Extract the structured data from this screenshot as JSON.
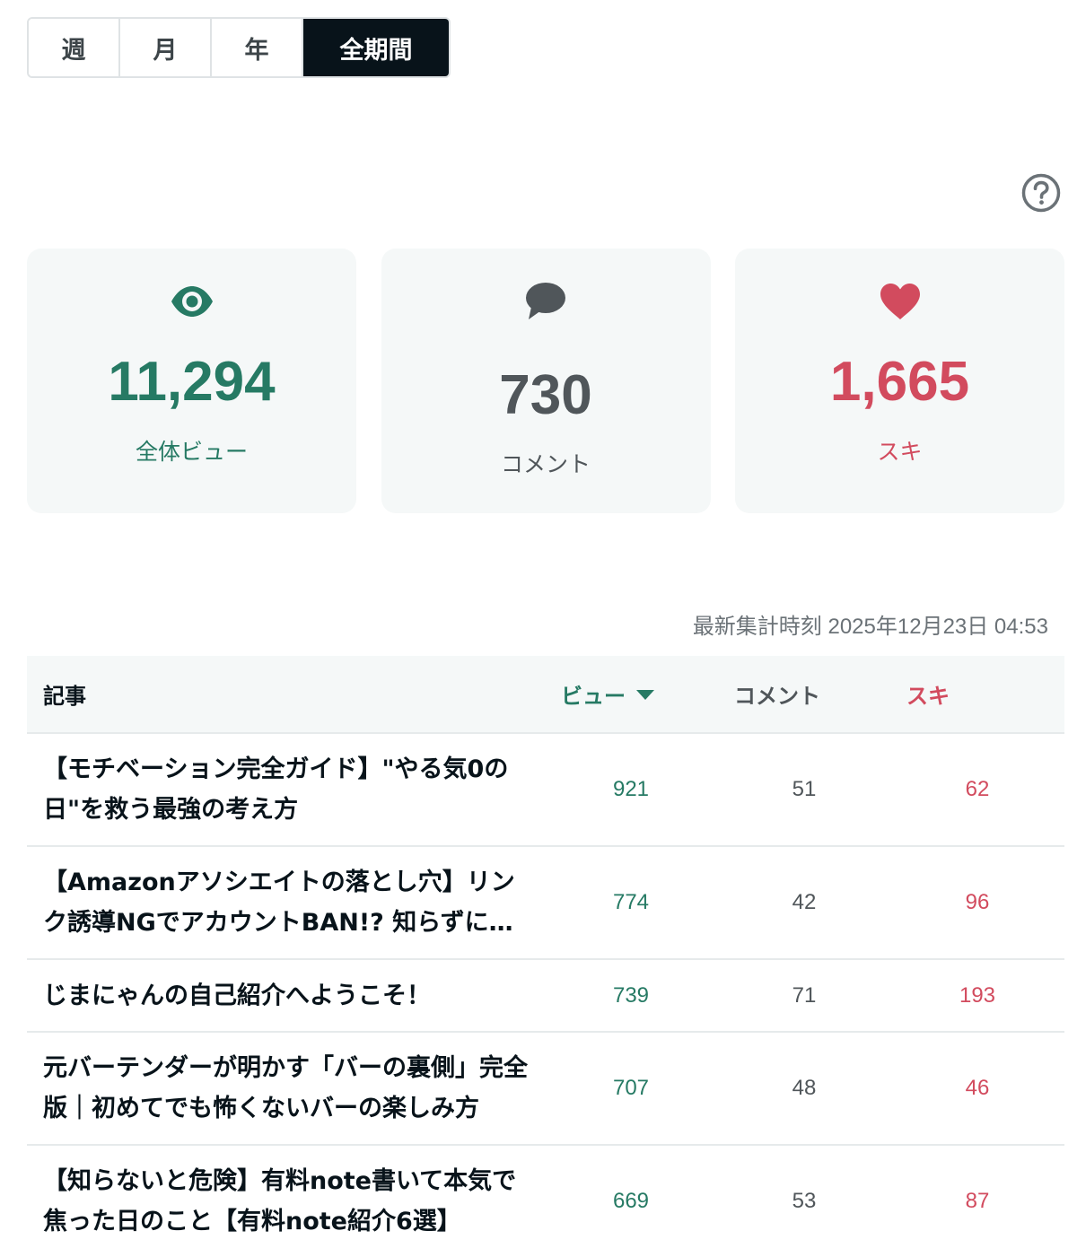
{
  "period_tabs": [
    {
      "label": "週",
      "active": false
    },
    {
      "label": "月",
      "active": false
    },
    {
      "label": "年",
      "active": false
    },
    {
      "label": "全期間",
      "active": true
    }
  ],
  "help": {
    "icon": "question-circle-icon"
  },
  "stats": {
    "views": {
      "value": "11,294",
      "label": "全体ビュー",
      "icon": "eye-icon",
      "color": "#267a64"
    },
    "comments": {
      "value": "730",
      "label": "コメント",
      "icon": "speech-bubble-icon",
      "color": "#50565a"
    },
    "likes": {
      "value": "1,665",
      "label": "スキ",
      "icon": "heart-icon",
      "color": "#d24b5e"
    }
  },
  "updated_at": "最新集計時刻 2025年12月23日 04:53",
  "table": {
    "headers": {
      "article": "記事",
      "views": "ビュー",
      "comments": "コメント",
      "likes": "スキ"
    },
    "rows": [
      {
        "title": "【モチベーション完全ガイド】\"やる気0の日\"を救う最強の考え方",
        "views": "921",
        "comments": "51",
        "likes": "62"
      },
      {
        "title": "【Amazonアソシエイトの落とし穴】リンク誘導NGでアカウントBAN!? 知らずにやっていたこと",
        "views": "774",
        "comments": "42",
        "likes": "96"
      },
      {
        "title": "じまにゃんの自己紹介へようこそ！",
        "views": "739",
        "comments": "71",
        "likes": "193"
      },
      {
        "title": "元バーテンダーが明かす「バーの裏側」完全版｜初めてでも怖くないバーの楽しみ方",
        "views": "707",
        "comments": "48",
        "likes": "46"
      },
      {
        "title": "【知らないと危険】有料note書いて本気で焦った日のこと【有料note紹介6選】",
        "views": "669",
        "comments": "53",
        "likes": "87"
      }
    ]
  }
}
